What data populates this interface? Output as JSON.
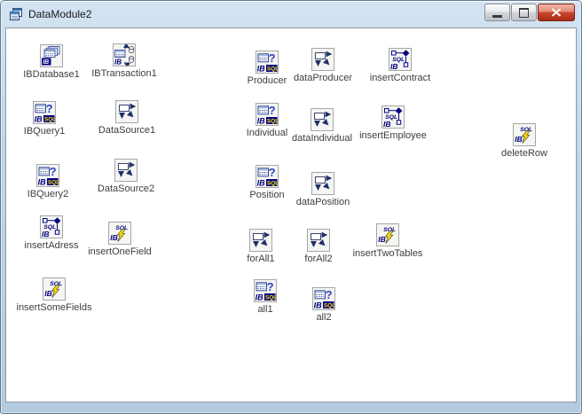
{
  "window": {
    "title": "DataModule2",
    "icons": {
      "app": "datamodule-window-icon",
      "minimize": "minimize-icon",
      "maximize": "maximize-icon",
      "close": "close-icon"
    }
  },
  "colors": {
    "ib_navy": "#000080",
    "sql_yellow": "#ffe400",
    "close_button_red": "#cd4730",
    "frame_blue": "#c2d6e8",
    "icon_background": "#f5f5f2"
  },
  "components": [
    {
      "label": "IBDatabase1",
      "type": "ibdatabase"
    },
    {
      "label": "IBTransaction1",
      "type": "ibtransaction"
    },
    {
      "label": "Producer",
      "type": "ibquery"
    },
    {
      "label": "dataProducer",
      "type": "datasource"
    },
    {
      "label": "insertContract",
      "type": "ibstoredproc"
    },
    {
      "label": "IBQuery1",
      "type": "ibquery"
    },
    {
      "label": "DataSource1",
      "type": "datasource"
    },
    {
      "label": "Individual",
      "type": "ibquery"
    },
    {
      "label": "dataIndividual",
      "type": "datasource"
    },
    {
      "label": "insertEmployee",
      "type": "ibstoredproc"
    },
    {
      "label": "deleteRow",
      "type": "ibsql"
    },
    {
      "label": "IBQuery2",
      "type": "ibquery"
    },
    {
      "label": "DataSource2",
      "type": "datasource"
    },
    {
      "label": "Position",
      "type": "ibquery"
    },
    {
      "label": "dataPosition",
      "type": "datasource"
    },
    {
      "label": "insertAdress",
      "type": "ibstoredproc"
    },
    {
      "label": "insertOneField",
      "type": "ibsql"
    },
    {
      "label": "forAll1",
      "type": "datasource"
    },
    {
      "label": "forAll2",
      "type": "datasource"
    },
    {
      "label": "insertTwoTables",
      "type": "ibsql"
    },
    {
      "label": "insertSomeFields",
      "type": "ibsql"
    },
    {
      "label": "all1",
      "type": "ibquery"
    },
    {
      "label": "all2",
      "type": "ibquery"
    }
  ]
}
